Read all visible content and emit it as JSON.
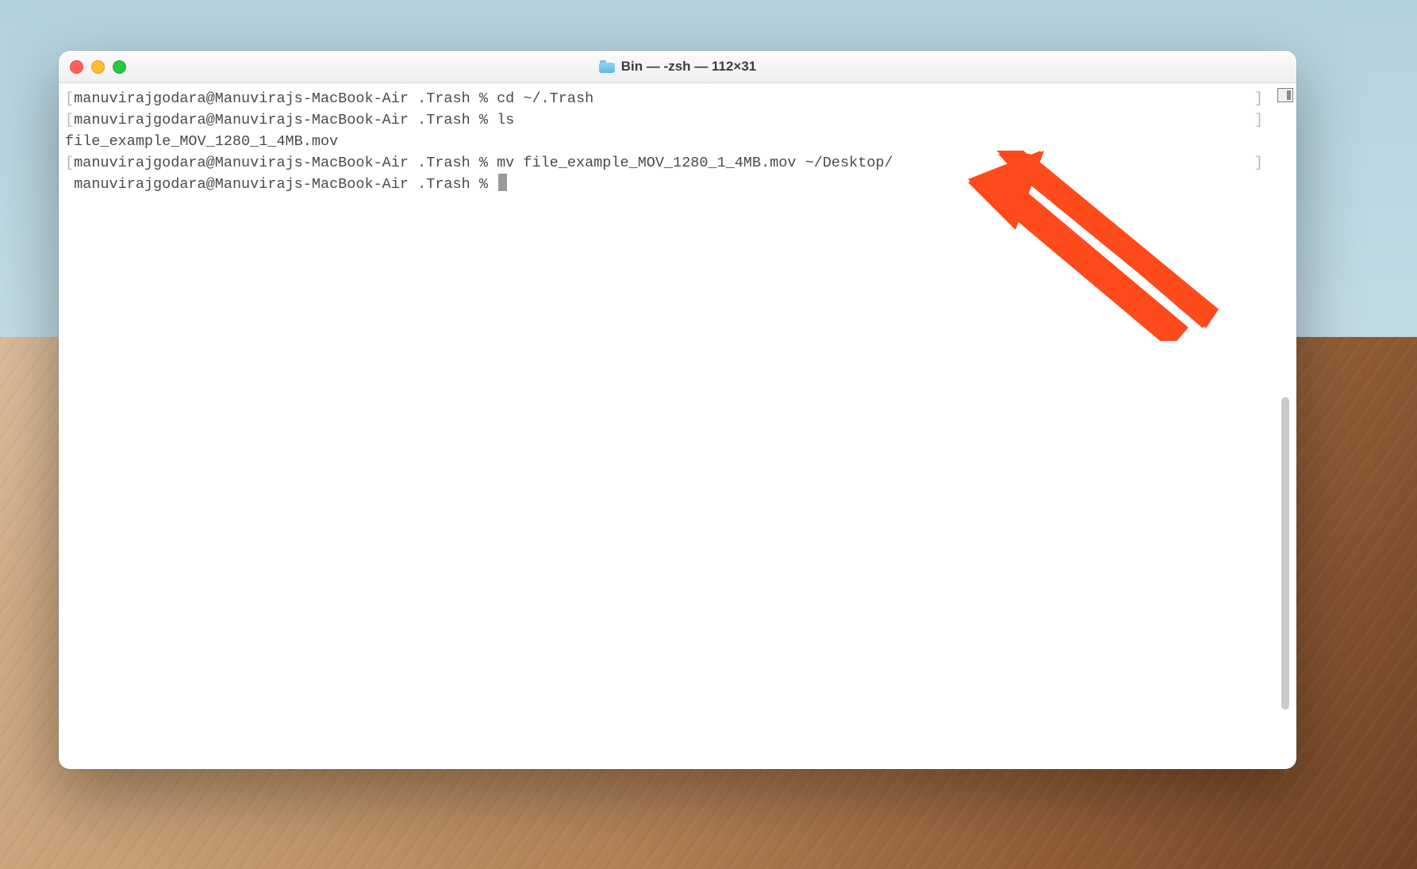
{
  "window": {
    "title": "Bin — -zsh — 112×31"
  },
  "prompt": {
    "user": "manuvirajgodara",
    "host": "Manuvirajs-MacBook-Air",
    "cwd": ".Trash",
    "symbol": "%"
  },
  "lines": {
    "l1_cmd": "cd ~/.Trash",
    "l2_cmd": "ls",
    "l3_output": "file_example_MOV_1280_1_4MB.mov",
    "l4_cmd": "mv file_example_MOV_1280_1_4MB.mov ~/Desktop/"
  },
  "annotation": {
    "type": "arrow",
    "color": "#ff4a1c"
  }
}
